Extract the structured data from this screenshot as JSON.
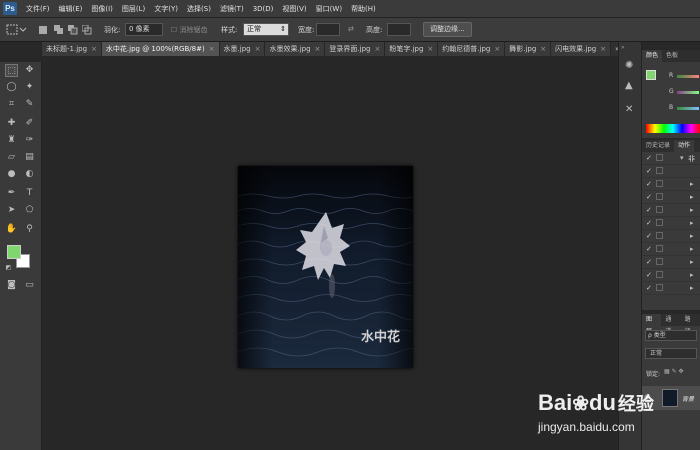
{
  "app": {
    "logo": "Ps"
  },
  "menu": [
    "文件(F)",
    "编辑(E)",
    "图像(I)",
    "图层(L)",
    "文字(Y)",
    "选择(S)",
    "滤镜(T)",
    "3D(D)",
    "视图(V)",
    "窗口(W)",
    "帮助(H)"
  ],
  "options": {
    "feather_label": "羽化:",
    "feather_value": "0 像素",
    "antialias_label": "消除锯齿",
    "style_label": "样式:",
    "style_value": "正常",
    "width_label": "宽度:",
    "height_label": "高度:",
    "refine_button": "调整边缘..."
  },
  "tabs": [
    {
      "label": "未标题-1.jpg",
      "active": false
    },
    {
      "label": "水中花.jpg @ 100%(RGB/8#)",
      "active": true
    },
    {
      "label": "水墨.jpg",
      "active": false
    },
    {
      "label": "水墨效果.jpg",
      "active": false
    },
    {
      "label": "登录界面.jpg",
      "active": false
    },
    {
      "label": "粉笔字.jpg",
      "active": false
    },
    {
      "label": "约翰尼德普.jpg",
      "active": false
    },
    {
      "label": "舞影.jpg",
      "active": false
    },
    {
      "label": "闪电效果.jpg",
      "active": false
    }
  ],
  "tab_overflow": "»",
  "document": {
    "watermark_text": "水中花"
  },
  "color_panel": {
    "tab1": "颜色",
    "tab2": "色板",
    "channels": [
      "R",
      "G",
      "B"
    ]
  },
  "history_panel": {
    "tab1": "历史记录",
    "tab2": "动作",
    "first_item": "非"
  },
  "layers_panel": {
    "tabs": [
      "图层",
      "通道",
      "路径"
    ],
    "filter_label": "ρ 类型",
    "blend_mode": "正常",
    "lock_label": "锁定:",
    "layer_name": "背景"
  },
  "watermark": {
    "brand_left": "Bai",
    "brand_right": "du",
    "brand_cn": "经验",
    "url": "jingyan.baidu.com"
  },
  "colors": {
    "foreground": "#7fd66f",
    "background": "#ffffff"
  }
}
